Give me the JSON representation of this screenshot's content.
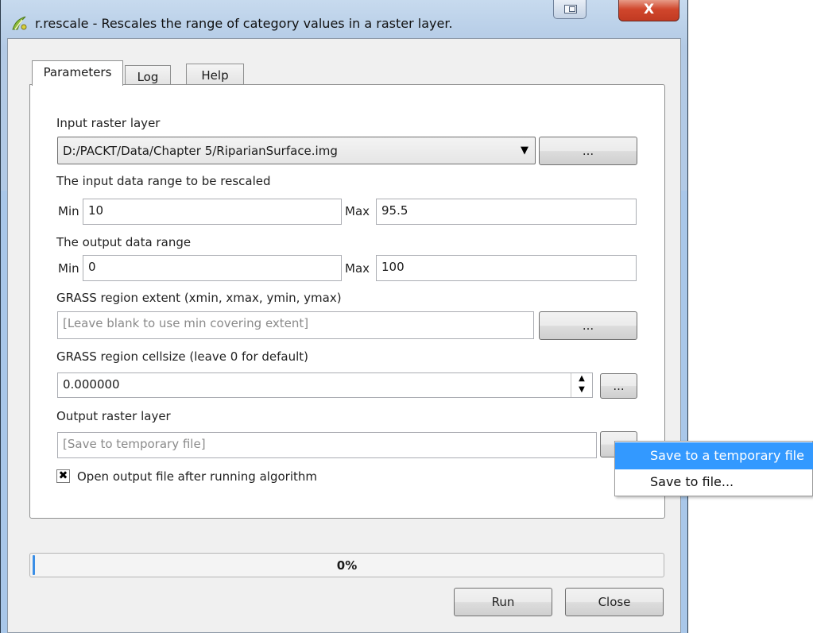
{
  "window": {
    "title": "r.rescale - Rescales the range of category values in a raster layer.",
    "close_glyph": "X"
  },
  "tabs": [
    {
      "label": "Parameters",
      "selected": true
    },
    {
      "label": "Log",
      "selected": false
    },
    {
      "label": "Help",
      "selected": false
    }
  ],
  "params": {
    "input_label": "Input raster layer",
    "input_value": "D:/PACKT/Data/Chapter 5/RiparianSurface.img",
    "browse_label": "...",
    "input_range_label": "The input data range to be rescaled",
    "input_min_label": "Min",
    "input_min_value": "10",
    "input_max_label": "Max",
    "input_max_value": "95.5",
    "output_range_label": "The output data range",
    "output_min_label": "Min",
    "output_min_value": "0",
    "output_max_label": "Max",
    "output_max_value": "100",
    "extent_label": "GRASS region extent (xmin, xmax, ymin, ymax)",
    "extent_placeholder": "[Leave blank to use min covering extent]",
    "cellsize_label": "GRASS region cellsize (leave 0 for default)",
    "cellsize_value": "0.000000",
    "output_label": "Output raster layer",
    "output_placeholder": "[Save to temporary file]",
    "open_output_label": "Open output file after running algorithm",
    "open_output_checked": true
  },
  "progress": {
    "value": 0,
    "text": "0%",
    "fill_color": "#3a8ee6"
  },
  "buttons": {
    "run": "Run",
    "close": "Close"
  },
  "context_menu": {
    "items": [
      {
        "label": "Save to a temporary file",
        "highlighted": true
      },
      {
        "label": "Save to file...",
        "highlighted": false
      }
    ],
    "highlight_color": "#3399ff"
  },
  "icons": {
    "app": "qgis-processing-icon",
    "checkbox_mark": "✖",
    "combo_arrow": "▼",
    "spin_up": "▲",
    "spin_down": "▼"
  }
}
